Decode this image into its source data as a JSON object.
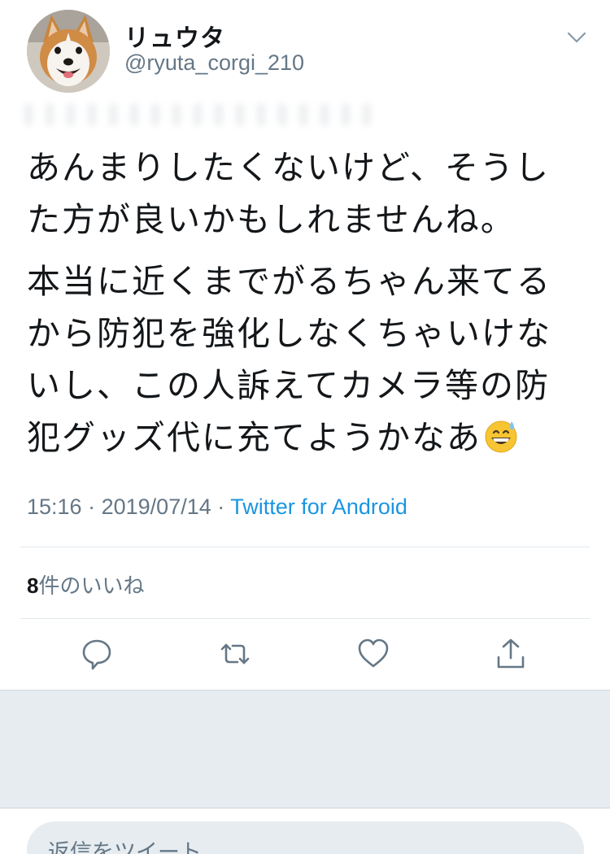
{
  "user": {
    "display_name": "リュウタ",
    "handle": "@ryuta_corgi_210"
  },
  "tweet": {
    "paragraphs": [
      "あんまりしたくないけど、そうした方が良いかもしれませんね。",
      "本当に近くまでがるちゃん来てるから防犯を強化しなくちゃいけないし、この人訴えてカメラ等の防犯グッズ代に充てようかなあ"
    ],
    "emoji": "grinning-face-with-sweat",
    "time": "15:16",
    "separator": "·",
    "date": "2019/07/14",
    "source": "Twitter for Android"
  },
  "likes": {
    "count": "8",
    "label": "件のいいね"
  },
  "actions": [
    "reply-icon",
    "retweet-icon",
    "like-icon",
    "share-icon"
  ],
  "reply_box": {
    "placeholder": "返信をツイート"
  },
  "colors": {
    "link": "#1b95e0",
    "secondary_text": "#657786",
    "divider": "#e1e8ed",
    "background_gray": "#e6ecf0"
  }
}
